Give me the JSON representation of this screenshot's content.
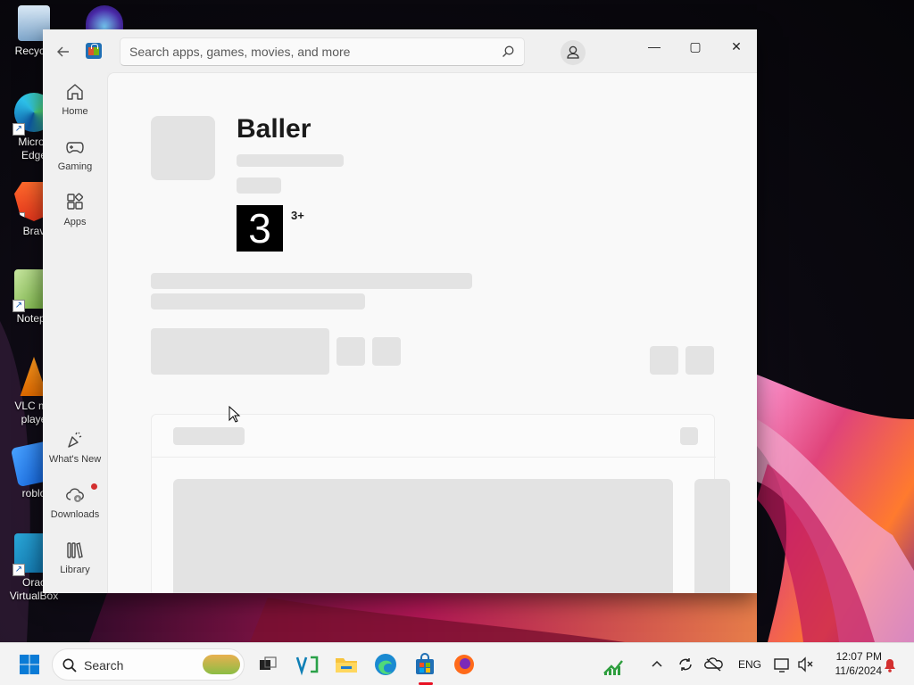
{
  "desktop": {
    "icons": [
      {
        "label": "Recycle",
        "name": "recycle-bin"
      },
      {
        "label": "Micros\nEdge",
        "name": "microsoft-edge"
      },
      {
        "label": "Brav",
        "name": "brave"
      },
      {
        "label": "Notepa",
        "name": "notepad"
      },
      {
        "label": "VLC me\nplaye",
        "name": "vlc"
      },
      {
        "label": "roblo",
        "name": "roblox"
      },
      {
        "label": "Orac\nVirtualBox",
        "name": "virtualbox"
      }
    ]
  },
  "store": {
    "search": {
      "placeholder": "Search apps, games, movies, and more"
    },
    "window_controls": {
      "minimize": "—",
      "maximize": "▢",
      "close": "✕"
    },
    "nav": {
      "home": "Home",
      "gaming": "Gaming",
      "apps": "Apps",
      "whats_new": "What's New",
      "downloads": "Downloads",
      "library": "Library"
    },
    "app": {
      "title": "Baller",
      "rating_number": "3",
      "rating_age": "3+"
    }
  },
  "taskbar": {
    "search_label": "Search",
    "language": "ENG",
    "time": "12:07 PM",
    "date": "11/6/2024"
  },
  "colors": {
    "accent": "#1f6fb5",
    "notification_red": "#d32f2f",
    "skeleton": "#e3e3e3"
  }
}
